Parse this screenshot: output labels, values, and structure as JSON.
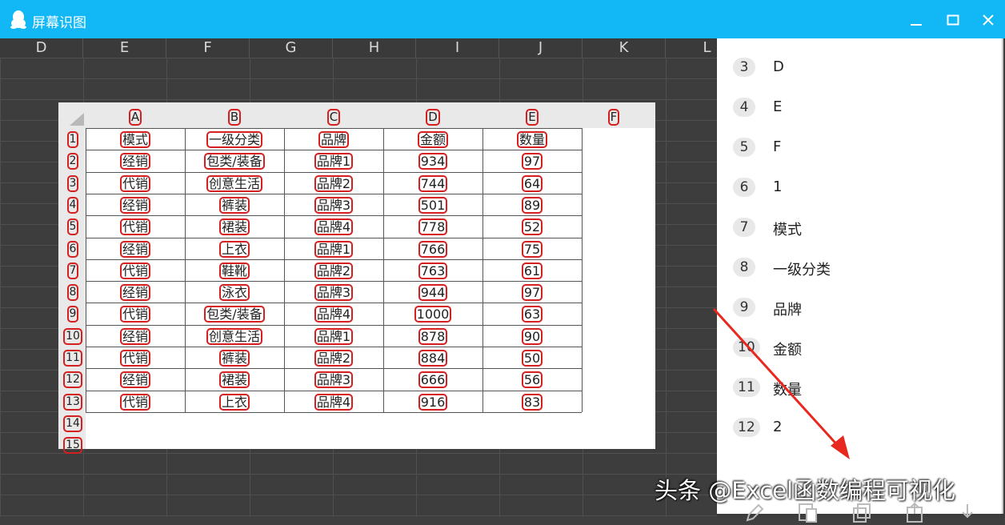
{
  "window": {
    "title": "屏幕识图",
    "minimize_icon": "minimize-icon",
    "maximize_icon": "maximize-icon",
    "close_icon": "close-icon"
  },
  "background_sheet": {
    "columns": [
      "D",
      "E",
      "F",
      "G",
      "H",
      "I",
      "J",
      "K",
      "L"
    ]
  },
  "captured_table": {
    "column_headers": [
      "A",
      "B",
      "C",
      "D",
      "E",
      "F"
    ],
    "row_numbers": [
      "1",
      "2",
      "3",
      "4",
      "5",
      "6",
      "7",
      "8",
      "9",
      "10",
      "11",
      "12",
      "13",
      "14",
      "15"
    ],
    "header": [
      "模式",
      "一级分类",
      "品牌",
      "金额",
      "数量"
    ],
    "rows": [
      [
        "经销",
        "包类/装备",
        "品牌1",
        "934",
        "97"
      ],
      [
        "代销",
        "创意生活",
        "品牌2",
        "744",
        "64"
      ],
      [
        "经销",
        "裤装",
        "品牌3",
        "501",
        "89"
      ],
      [
        "代销",
        "裙装",
        "品牌4",
        "778",
        "52"
      ],
      [
        "经销",
        "上衣",
        "品牌1",
        "766",
        "75"
      ],
      [
        "代销",
        "鞋靴",
        "品牌2",
        "763",
        "61"
      ],
      [
        "经销",
        "泳衣",
        "品牌3",
        "944",
        "97"
      ],
      [
        "代销",
        "包类/装备",
        "品牌4",
        "1000",
        "63"
      ],
      [
        "经销",
        "创意生活",
        "品牌1",
        "878",
        "90"
      ],
      [
        "代销",
        "裤装",
        "品牌2",
        "884",
        "50"
      ],
      [
        "经销",
        "裙装",
        "品牌3",
        "666",
        "56"
      ],
      [
        "代销",
        "上衣",
        "品牌4",
        "916",
        "83"
      ]
    ]
  },
  "result_list": [
    {
      "num": "3",
      "text": "D"
    },
    {
      "num": "4",
      "text": "E"
    },
    {
      "num": "5",
      "text": "F"
    },
    {
      "num": "6",
      "text": "1"
    },
    {
      "num": "7",
      "text": "模式"
    },
    {
      "num": "8",
      "text": "一级分类"
    },
    {
      "num": "9",
      "text": "品牌"
    },
    {
      "num": "10",
      "text": "金额"
    },
    {
      "num": "11",
      "text": "数量"
    },
    {
      "num": "12",
      "text": "2"
    }
  ],
  "toolbar_icons": [
    "edit-icon",
    "translate-icon",
    "copy-icon",
    "export-icon",
    "download-icon"
  ],
  "watermark": "头条 @Excel函数编程可视化",
  "colors": {
    "titlebar": "#12b7f5",
    "ocr_box": "#d42020",
    "arrow": "#e8281e"
  }
}
